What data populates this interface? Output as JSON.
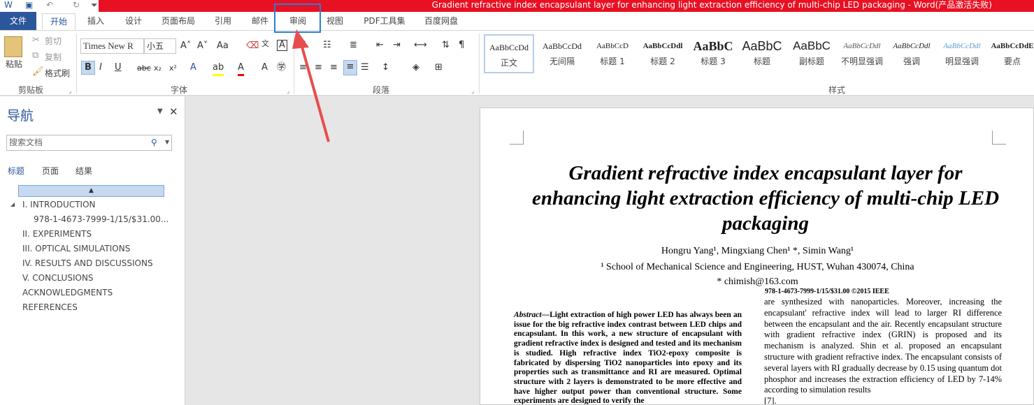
{
  "window": {
    "title": "Gradient refractive index encapsulant layer for enhancing light extraction efficiency of multi-chip LED packaging -  Word(产品激活失败)"
  },
  "tabs": [
    "文件",
    "开始",
    "插入",
    "设计",
    "页面布局",
    "引用",
    "邮件",
    "审阅",
    "视图",
    "PDF工具集",
    "百度网盘"
  ],
  "clipboard": {
    "paste": "粘贴",
    "cut": "剪切",
    "copy": "复制",
    "format_painter": "格式刷",
    "label": "剪贴板"
  },
  "font": {
    "name": "Times New R",
    "size": "小五",
    "label": "字体",
    "aa": "Aa"
  },
  "paragraph": {
    "label": "段落"
  },
  "styles": {
    "label": "样式",
    "items": [
      {
        "preview": "AaBbCcDd",
        "name": "正文"
      },
      {
        "preview": "AaBbCcDd",
        "name": "无间隔"
      },
      {
        "preview": "AaBbCcD",
        "name": "标题 1"
      },
      {
        "preview": "AaBbCcDdl",
        "name": "标题 2"
      },
      {
        "preview": "AaBbC",
        "name": "标题 3"
      },
      {
        "preview": "AaBbC",
        "name": "标题"
      },
      {
        "preview": "AaBbC",
        "name": "副标题"
      },
      {
        "preview": "AaBbCcDdl",
        "name": "不明显强调"
      },
      {
        "preview": "AaBbCcDdl",
        "name": "强调"
      },
      {
        "preview": "AaBbCcDdl",
        "name": "明显强调"
      },
      {
        "preview": "AaBbCcDdE",
        "name": "要点"
      }
    ]
  },
  "nav": {
    "title": "导航",
    "search_placeholder": "搜索文档",
    "tabs": [
      "标题",
      "页面",
      "结果"
    ],
    "headings": [
      "I. INTRODUCTION",
      "978-1-4673-7999-1/15/$31.00...",
      "II. EXPERIMENTS",
      "III. OPTICAL SIMULATIONS",
      "IV. RESULTS AND DISCUSSIONS",
      "V. CONCLUSIONS",
      "ACKNOWLEDGMENTS",
      "REFERENCES"
    ]
  },
  "doc": {
    "title": "Gradient refractive index encapsulant layer for enhancing light extraction efficiency of multi-chip LED packaging",
    "authors": "Hongru Yang¹, Mingxiang Chen¹ *, Simin Wang¹",
    "affiliation": "¹ School of Mechanical Science and Engineering, HUST, Wuhan 430074, China",
    "email": "* chimish@163.com",
    "footnote": "978-1-4673-7999-1/15/$31.00 ©2015 IEEE",
    "abstract_label": "Abstract—",
    "abstract_text": "Light extraction of high power LED has always been an issue for the big refractive index contrast between LED chips and encapsulant. In this work, a new structure of encapsulant with gradient refractive index is designed and tested and its mechanism is studied. High refractive index TiO2-epoxy composite is fabricated by dispersing TiO2 nanoparticles into epoxy and its properties such as transmittance and RI are measured. Optimal structure with 2 layers is demonstrated to be more effective and have higher output power than conventional structure. Some experiments are designed to verify the",
    "right_col": "are synthesized with nanoparticles. Moreover, increasing the encapsulant' refractive index will lead to larger RI difference between the encapsulant and the air. Recently encapsulant structure with gradient refractive index (GRIN) is proposed and its mechanism is analyzed. Shin et al. proposed an encapsulant structure with gradient refractive index. The encapsulant consists of several layers with RI gradually decrease by 0.15 using quantum dot phosphor and increases the extraction efficiency of LED by 7-14% according to simulation results",
    "right_ref": "[7]."
  }
}
